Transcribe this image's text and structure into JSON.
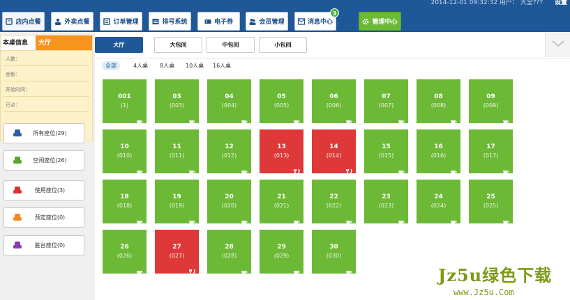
{
  "topbar": {
    "status_text": "2014-12-01 09:32:32  用户：   大堂???",
    "logout_label": "设置",
    "buttons": [
      {
        "label": "店内点餐",
        "icon": "dine-in-icon"
      },
      {
        "label": "外卖点餐",
        "icon": "takeaway-icon"
      },
      {
        "label": "订单管理",
        "icon": "order-icon"
      },
      {
        "label": "排号系统",
        "icon": "queue-icon"
      },
      {
        "label": "电子券",
        "icon": "coupon-icon"
      },
      {
        "label": "会员管理",
        "icon": "member-icon"
      },
      {
        "label": "消息中心",
        "icon": "message-icon",
        "badge": "3"
      },
      {
        "label": "管理中心",
        "icon": "gear-icon"
      }
    ]
  },
  "info": {
    "title": "本桌信息",
    "area": "大厅",
    "fields": [
      "人数：",
      "金额：",
      "开始时间：",
      "已点："
    ]
  },
  "filters": [
    {
      "label": "所有座位(29)",
      "color": "#2b5ea8"
    },
    {
      "label": "空闲座位(26)",
      "color": "#5aa52f"
    },
    {
      "label": "使用座位(3)",
      "color": "#d8332f"
    },
    {
      "label": "预定座位(0)",
      "color": "#f08a1c"
    },
    {
      "label": "脏台座位(0)",
      "color": "#8a3db3"
    }
  ],
  "areas": [
    "大厅",
    "大包间",
    "中包间",
    "小包间"
  ],
  "capacities": [
    "全部",
    "4人桌",
    "8人桌",
    "10人桌",
    "16人桌"
  ],
  "tables": [
    {
      "num": "001",
      "code": "(1)",
      "status": "idle"
    },
    {
      "num": "03",
      "code": "(003)",
      "status": "idle"
    },
    {
      "num": "04",
      "code": "(004)",
      "status": "idle"
    },
    {
      "num": "05",
      "code": "(005)",
      "status": "idle"
    },
    {
      "num": "06",
      "code": "(006)",
      "status": "idle"
    },
    {
      "num": "07",
      "code": "(007)",
      "status": "idle"
    },
    {
      "num": "08",
      "code": "(008)",
      "status": "idle"
    },
    {
      "num": "09",
      "code": "(009)",
      "status": "idle"
    },
    {
      "num": "10",
      "code": "(010)",
      "status": "idle"
    },
    {
      "num": "11",
      "code": "(011)",
      "status": "idle"
    },
    {
      "num": "12",
      "code": "(012)",
      "status": "idle"
    },
    {
      "num": "13",
      "code": "(013)",
      "status": "busy"
    },
    {
      "num": "14",
      "code": "(014)",
      "status": "busy"
    },
    {
      "num": "15",
      "code": "(015)",
      "status": "idle"
    },
    {
      "num": "16",
      "code": "(016)",
      "status": "idle"
    },
    {
      "num": "17",
      "code": "(017)",
      "status": "idle"
    },
    {
      "num": "18",
      "code": "(018)",
      "status": "idle"
    },
    {
      "num": "19",
      "code": "(019)",
      "status": "idle"
    },
    {
      "num": "20",
      "code": "(020)",
      "status": "idle"
    },
    {
      "num": "21",
      "code": "(021)",
      "status": "idle"
    },
    {
      "num": "22",
      "code": "(022)",
      "status": "idle"
    },
    {
      "num": "23",
      "code": "(023)",
      "status": "idle"
    },
    {
      "num": "24",
      "code": "(024)",
      "status": "idle"
    },
    {
      "num": "25",
      "code": "(025)",
      "status": "idle"
    },
    {
      "num": "26",
      "code": "(026)",
      "status": "idle"
    },
    {
      "num": "27",
      "code": "(027)",
      "status": "busy"
    },
    {
      "num": "28",
      "code": "(028)",
      "status": "idle"
    },
    {
      "num": "29",
      "code": "(029)",
      "status": "idle"
    },
    {
      "num": "30",
      "code": "(030)",
      "status": "idle"
    }
  ],
  "watermark": {
    "line1": "Jz5u绿色下载",
    "line2": "www.Jz5u.Com"
  }
}
